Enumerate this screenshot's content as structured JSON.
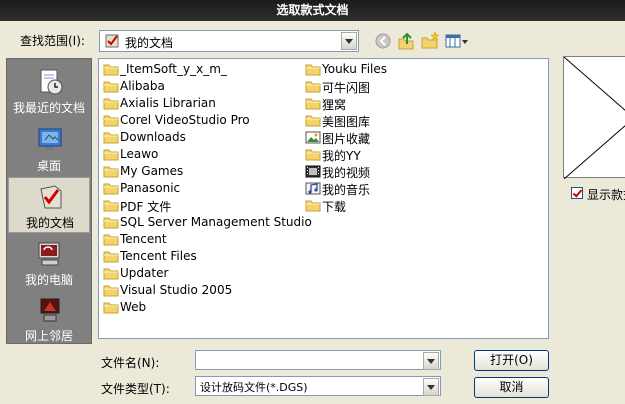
{
  "dialog": {
    "title": "选取款式文档"
  },
  "lookin": {
    "label": "查找范围(I):",
    "value": "我的文档"
  },
  "places": [
    {
      "label": "我最近的文档",
      "icon": "recent-documents-icon",
      "active": false
    },
    {
      "label": "桌面",
      "icon": "desktop-icon",
      "active": false
    },
    {
      "label": "我的文档",
      "icon": "my-documents-icon",
      "active": true
    },
    {
      "label": "我的电脑",
      "icon": "my-computer-icon",
      "active": false
    },
    {
      "label": "网上邻居",
      "icon": "network-places-icon",
      "active": false
    }
  ],
  "files": {
    "col1": [
      {
        "name": "_ItemSoft_y_x_m_",
        "type": "folder"
      },
      {
        "name": "Alibaba",
        "type": "folder"
      },
      {
        "name": "Axialis Librarian",
        "type": "folder"
      },
      {
        "name": "Corel VideoStudio Pro",
        "type": "folder"
      },
      {
        "name": "Downloads",
        "type": "folder"
      },
      {
        "name": "Leawo",
        "type": "folder"
      },
      {
        "name": "My Games",
        "type": "folder"
      },
      {
        "name": "Panasonic",
        "type": "folder"
      },
      {
        "name": "PDF 文件",
        "type": "folder"
      },
      {
        "name": "SQL Server Management Studio",
        "type": "folder"
      },
      {
        "name": "Tencent",
        "type": "folder"
      },
      {
        "name": "Tencent Files",
        "type": "folder"
      },
      {
        "name": "Updater",
        "type": "folder"
      },
      {
        "name": "Visual Studio 2005",
        "type": "folder"
      },
      {
        "name": "Web",
        "type": "folder"
      }
    ],
    "col2": [
      {
        "name": "Youku Files",
        "type": "folder"
      },
      {
        "name": "可牛闪图",
        "type": "folder"
      },
      {
        "name": "狸窝",
        "type": "folder"
      },
      {
        "name": "美图图库",
        "type": "folder"
      },
      {
        "name": "图片收藏",
        "type": "pictures"
      },
      {
        "name": "我的YY",
        "type": "folder"
      },
      {
        "name": "我的视频",
        "type": "video"
      },
      {
        "name": "我的音乐",
        "type": "music"
      },
      {
        "name": "下载",
        "type": "folder"
      }
    ]
  },
  "preview": {
    "show_label": "显示款式"
  },
  "filename": {
    "label": "文件名(N):",
    "value": ""
  },
  "filetype": {
    "label": "文件类型(T):",
    "value": "设计放码文件(*.DGS)"
  },
  "buttons": {
    "open": "打开(O)",
    "cancel": "取消"
  },
  "colors": {
    "folder": "#f5d36b",
    "folder_edge": "#c9a23a",
    "accent": "#003c74"
  }
}
